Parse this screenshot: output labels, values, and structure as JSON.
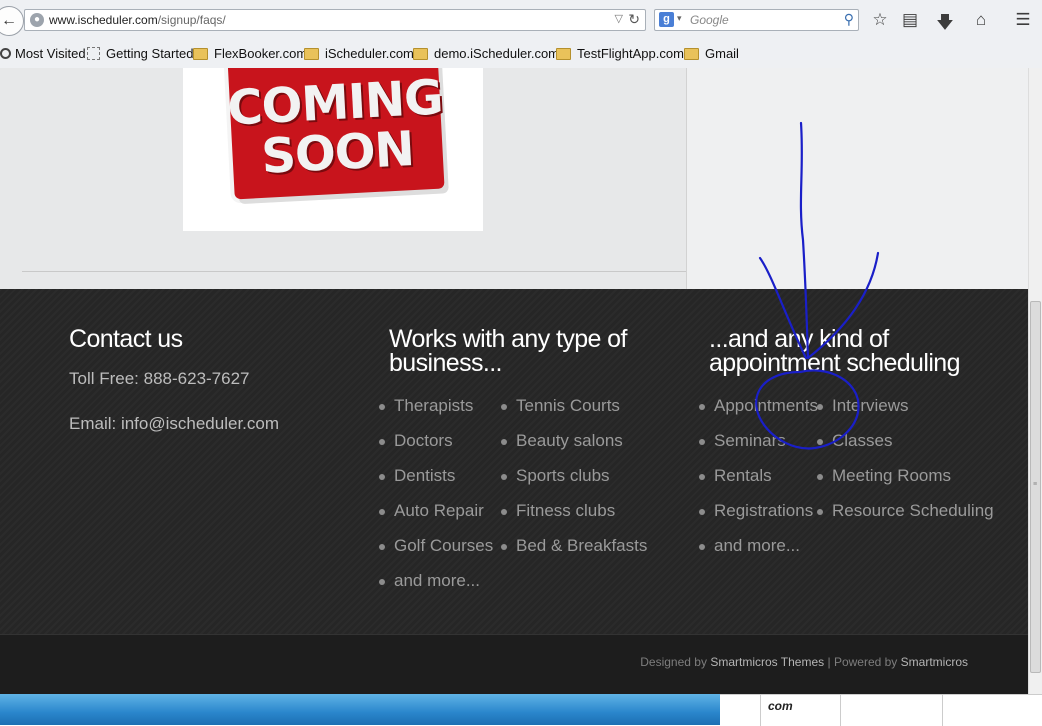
{
  "browser": {
    "url_domain": "www.ischeduler.com",
    "url_path": "/signup/faqs/",
    "search_engine": "Google",
    "search_placeholder": "Google",
    "bookmarks": [
      "Most Visited",
      "Getting Started",
      "FlexBooker.com",
      "iScheduler.com",
      "demo.iScheduler.com",
      "TestFlightApp.com",
      "Gmail"
    ],
    "toolbar_icons": [
      "star-icon",
      "reading-list-icon",
      "download-icon",
      "home-icon",
      "menu-icon"
    ]
  },
  "hero_image": {
    "line1": "COMING",
    "line2": "SOON"
  },
  "footer": {
    "contact": {
      "title": "Contact us",
      "phone": "Toll Free: 888-623-7627",
      "email": "Email: info@ischeduler.com"
    },
    "business": {
      "title_line1": "Works with any type of",
      "title_line2": "business...",
      "col1": [
        "Therapists",
        "Doctors",
        "Dentists",
        "Auto Repair",
        "Golf Courses",
        "and more..."
      ],
      "col2": [
        "Tennis Courts",
        "Beauty salons",
        "Sports clubs",
        "Fitness clubs",
        "Bed & Breakfasts"
      ]
    },
    "appointments": {
      "title_line1": "...and any kind of",
      "title_line2": "appointment scheduling",
      "col1": [
        "Appointments",
        "Seminars",
        "Rentals",
        "Registrations",
        "and more..."
      ],
      "col2": [
        "Interviews",
        "Classes",
        "Meeting Rooms",
        "Resource Scheduling"
      ]
    }
  },
  "credits": {
    "designed_by": "Designed by",
    "designer": "Smartmicros Themes",
    "separator": "|",
    "powered_by": "Powered by",
    "powered": "Smartmicros"
  },
  "taskbar_panel_text": "com",
  "colors": {
    "footer_bg": "#262626",
    "footer_title": "#ffffff",
    "footer_list": "#9a9a9a",
    "sign_red": "#c8141c",
    "annotation_ink": "#1a1fc8"
  }
}
